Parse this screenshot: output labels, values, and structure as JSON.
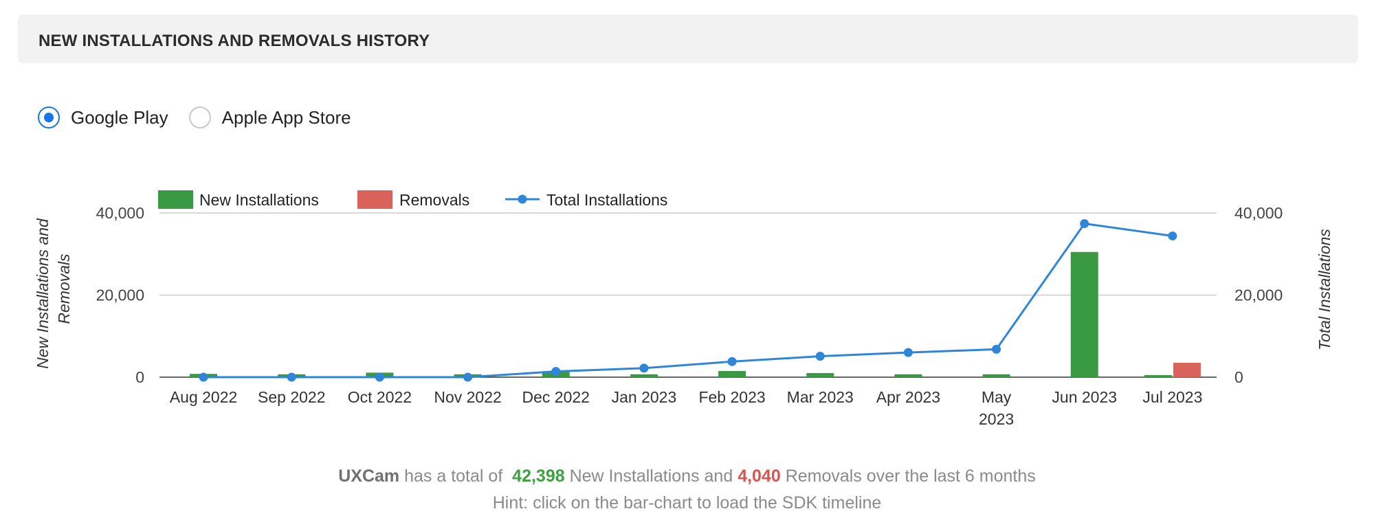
{
  "header": {
    "title": "NEW INSTALLATIONS AND REMOVALS HISTORY"
  },
  "store_toggle": {
    "options": [
      {
        "label": "Google Play",
        "selected": true
      },
      {
        "label": "Apple App Store",
        "selected": false
      }
    ]
  },
  "chart_data": {
    "type": "bar",
    "categories": [
      "Aug 2022",
      "Sep 2022",
      "Oct 2022",
      "Nov 2022",
      "Dec 2022",
      "Jan 2023",
      "Feb 2023",
      "Mar 2023",
      "Apr 2023",
      "May 2023",
      "Jun 2023",
      "Jul 2023"
    ],
    "category_display": [
      [
        "Aug 2022"
      ],
      [
        "Sep 2022"
      ],
      [
        "Oct 2022"
      ],
      [
        "Nov 2022"
      ],
      [
        "Dec 2022"
      ],
      [
        "Jan 2023"
      ],
      [
        "Feb 2023"
      ],
      [
        "Mar 2023"
      ],
      [
        "Apr 2023"
      ],
      [
        "May",
        "2023"
      ],
      [
        "Jun 2023"
      ],
      [
        "Jul 2023"
      ]
    ],
    "series": [
      {
        "name": "New Installations",
        "type": "bar",
        "axis": "left",
        "color": "#3a9a43",
        "values": [
          800,
          700,
          1100,
          700,
          1300,
          700,
          1500,
          1000,
          700,
          700,
          30500,
          500
        ]
      },
      {
        "name": "Removals",
        "type": "bar",
        "axis": "left",
        "color": "#d9625b",
        "values": [
          0,
          0,
          0,
          0,
          0,
          0,
          0,
          0,
          0,
          0,
          0,
          3500
        ]
      },
      {
        "name": "Total Installations",
        "type": "line",
        "axis": "right",
        "color": "#2f86d9",
        "values": [
          0,
          0,
          0,
          0,
          1400,
          2200,
          3800,
          5100,
          6000,
          6800,
          37400,
          34400
        ]
      }
    ],
    "ylabel": "New Installations and Removals",
    "ylabel_right": "Total Installations",
    "ylim": [
      0,
      40000
    ],
    "ylim_right": [
      0,
      40000
    ],
    "yticks": [
      0,
      20000,
      40000
    ],
    "ytick_labels": [
      "0",
      "20,000",
      "40,000"
    ],
    "grid": true,
    "legend_position": "top-left"
  },
  "summary": {
    "brand": "UXCam",
    "text_before": "has a total of",
    "new_installs": "42,398",
    "text_middle": "New Installations and",
    "removals": "4,040",
    "text_after": "Removals over the last 6 months"
  },
  "hint": "Hint: click on the bar-chart to load the SDK timeline"
}
